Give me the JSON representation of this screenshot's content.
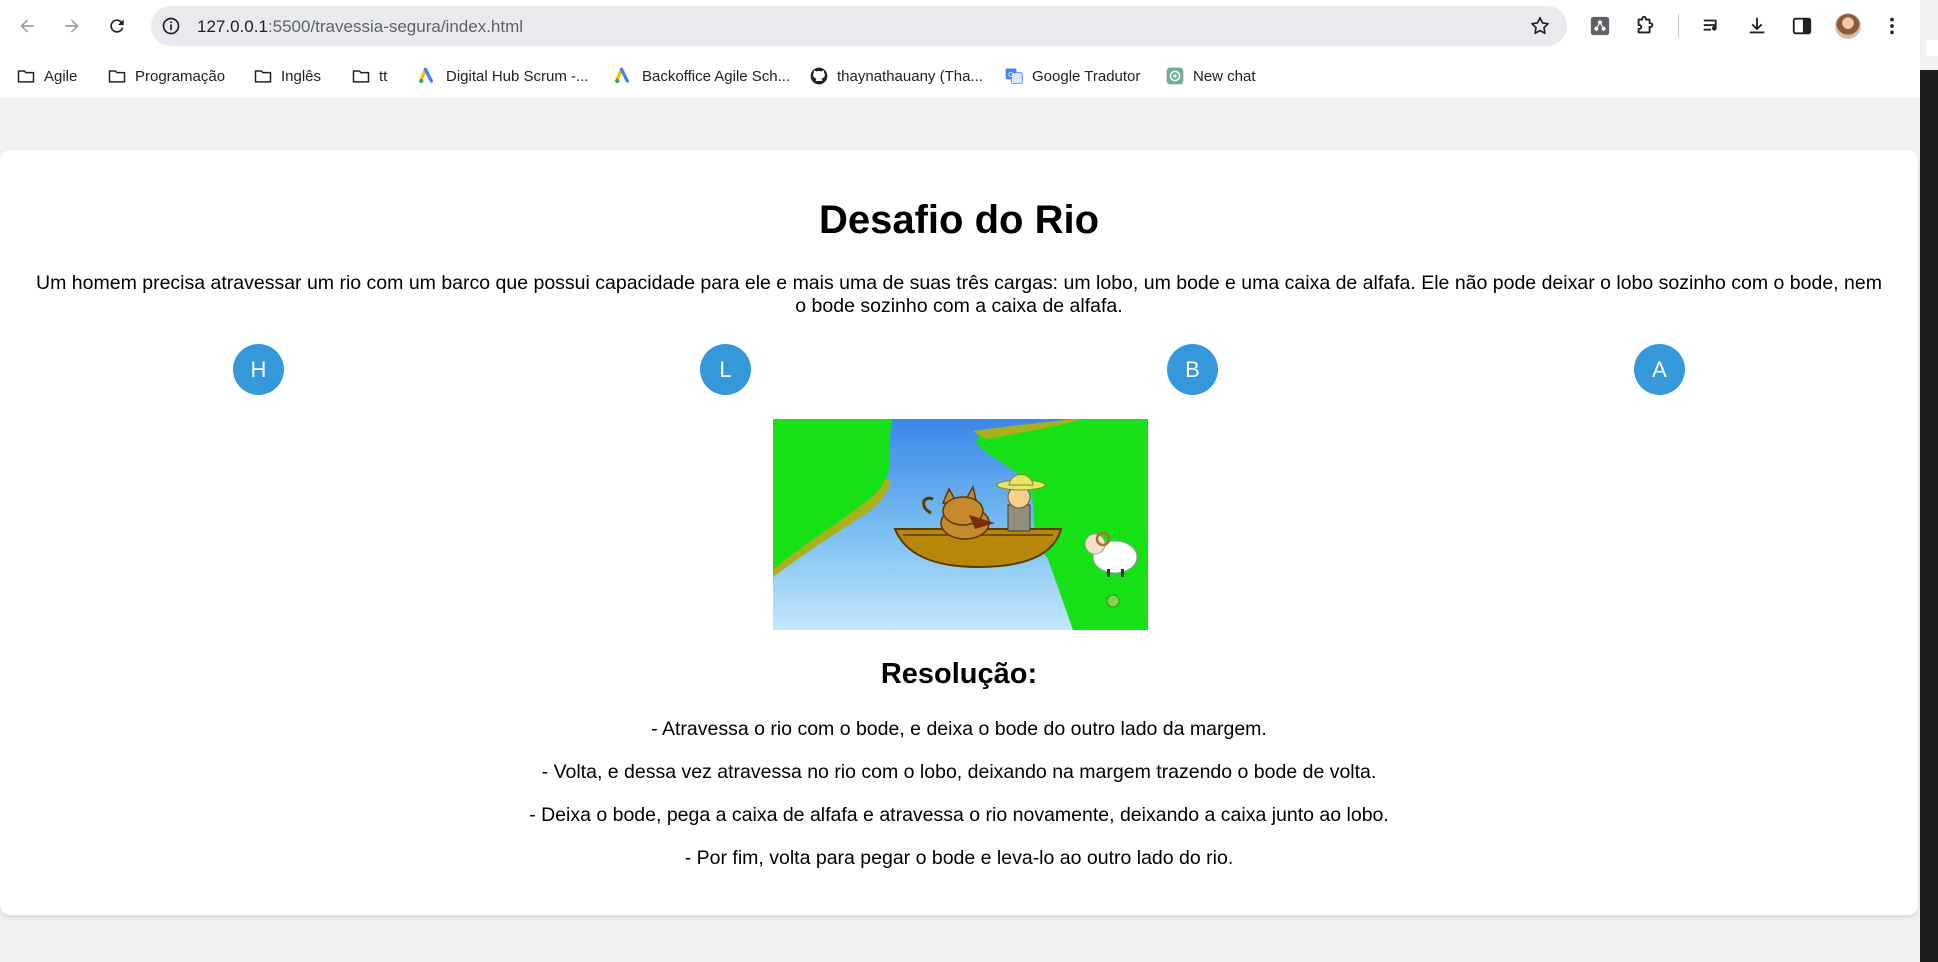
{
  "browser": {
    "url_host": "127.0.0.1",
    "url_path": ":5500/travessia-segura/index.html",
    "icons": [
      "back-arrow-icon",
      "forward-arrow-icon",
      "reload-icon",
      "site-info-icon",
      "star-icon",
      "extension-icon",
      "puzzle-icon",
      "media-queue-icon",
      "download-icon",
      "side-panel-icon",
      "menu-dots-icon"
    ]
  },
  "bookmarks": [
    {
      "label": "Agile",
      "icon": "folder-icon"
    },
    {
      "label": "Programação",
      "icon": "folder-icon"
    },
    {
      "label": "Inglês",
      "icon": "folder-icon"
    },
    {
      "label": "tt",
      "icon": "folder-icon"
    },
    {
      "label": "Digital Hub Scrum -...",
      "icon": "google-ads-icon"
    },
    {
      "label": "Backoffice Agile Sch...",
      "icon": "google-ads-icon"
    },
    {
      "label": "thaynathauany (Tha...",
      "icon": "github-icon"
    },
    {
      "label": "Google Tradutor",
      "icon": "translate-icon"
    },
    {
      "label": "New chat",
      "icon": "chatgpt-icon"
    }
  ],
  "page": {
    "title": "Desafio do Rio",
    "intro": "Um homem precisa atravessar um rio com um barco que possui capacidade para ele e mais uma de suas três cargas: um lobo, um bode e uma caixa de alfafa. Ele não pode deixar o lobo sozinho com o bode, nem o bode sozinho com a caixa de alfafa.",
    "tokens": [
      "H",
      "L",
      "B",
      "A"
    ],
    "resolution_title": "Resolução:",
    "steps": [
      "- Atravessa o rio com o bode, e deixa o bode do outro lado da margem.",
      "- Volta, e dessa vez atravessa no rio com o lobo, deixando na margem trazendo o bode de volta.",
      "- Deixa o bode, pega a caixa de alfafa e atravessa o rio novamente, deixando a caixa junto ao lobo.",
      "- Por fim, volta para pegar o bode e leva-lo ao outro lado do rio."
    ]
  },
  "colors": {
    "token_bg": "#3498db",
    "grass": "#22dd22",
    "river": "#4a90e2"
  }
}
